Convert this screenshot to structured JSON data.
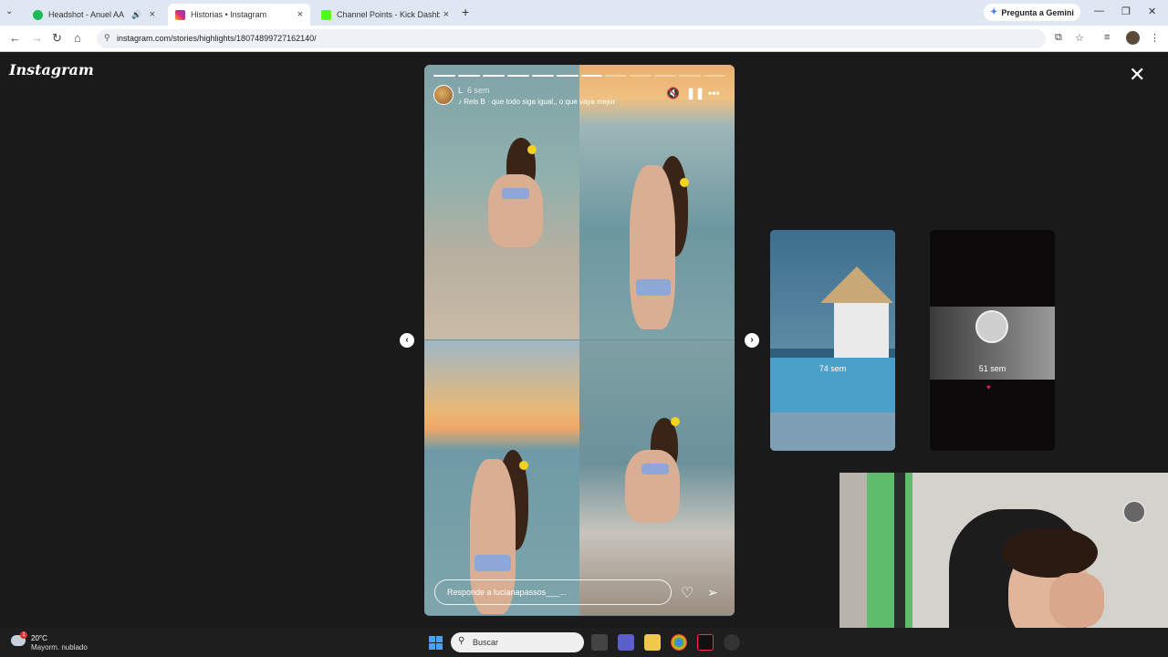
{
  "browser": {
    "tabs": [
      {
        "title": "Headshot - Anuel AA",
        "favicon_color": "#1db954",
        "audio": true
      },
      {
        "title": "Historias • Instagram",
        "favicon_color": "#d62976",
        "active": true
      },
      {
        "title": "Channel Points - Kick Dashboard",
        "favicon_color": "#53fc18"
      }
    ],
    "gemini_label": "Pregunta a Gemini",
    "url": "instagram.com/stories/highlights/18074899727162140/"
  },
  "instagram": {
    "logo": "Instagram",
    "story": {
      "username": "L",
      "time": "6 sem",
      "music": "Rels B · que todo siga igual,, o que vaya mejor",
      "reply_placeholder": "Responde a lucianapassos___...",
      "segments_total": 12,
      "segments_done": 7
    },
    "next_cards": [
      {
        "time": "74 sem"
      },
      {
        "time": "51 sem"
      }
    ]
  },
  "taskbar": {
    "temperature": "20°C",
    "weather": "Mayorm. nublado",
    "weather_badge": "1",
    "search_placeholder": "Buscar"
  },
  "icons": {
    "mute": "speaker-muted-icon",
    "pause": "pause-icon",
    "more": "more-icon",
    "like": "heart-icon",
    "share": "send-icon",
    "close": "close-icon"
  }
}
